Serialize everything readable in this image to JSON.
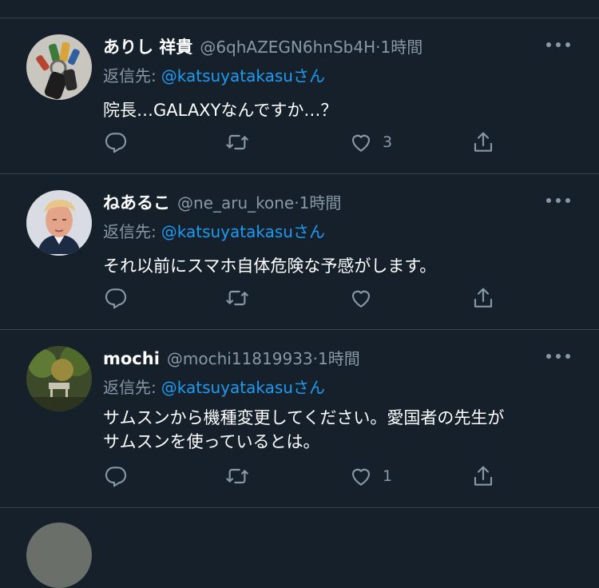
{
  "colors": {
    "background": "#15202b",
    "divider": "#38444d",
    "muted": "#8899a6",
    "link": "#1d9bf0",
    "text": "#ffffff"
  },
  "tweets": [
    {
      "name": "ありし 祥貴",
      "handle": "@6qhAZEGN6hnSb4H",
      "time": "·1時間",
      "reply_label": "返信先:",
      "reply_handle": "@katsuyatakasu",
      "reply_suffix": "さん",
      "text": "院長…GALAXYなんですか…？",
      "likes": "3",
      "avatar": "keys-photo"
    },
    {
      "name": "ねあるこ",
      "handle": "@ne_aru_kone",
      "time": "·1時間",
      "reply_label": "返信先:",
      "reply_handle": "@katsuyatakasu",
      "reply_suffix": "さん",
      "text": "それ以前にスマホ自体危険な予感がします。",
      "likes": "",
      "avatar": "portrait-photo"
    },
    {
      "name": "mochi",
      "handle": "@mochi11819933",
      "time": "·1時間",
      "reply_label": "返信先:",
      "reply_handle": "@katsuyatakasu",
      "reply_suffix": "さん",
      "text": "サムスンから機種変更してください。愛国者の先生が\nサムスンを使っているとは。",
      "likes": "1",
      "avatar": "forest-photo"
    }
  ],
  "icons": {
    "reply": "reply-icon",
    "retweet": "retweet-icon",
    "like": "heart-icon",
    "share": "share-icon",
    "more": "more-icon"
  }
}
